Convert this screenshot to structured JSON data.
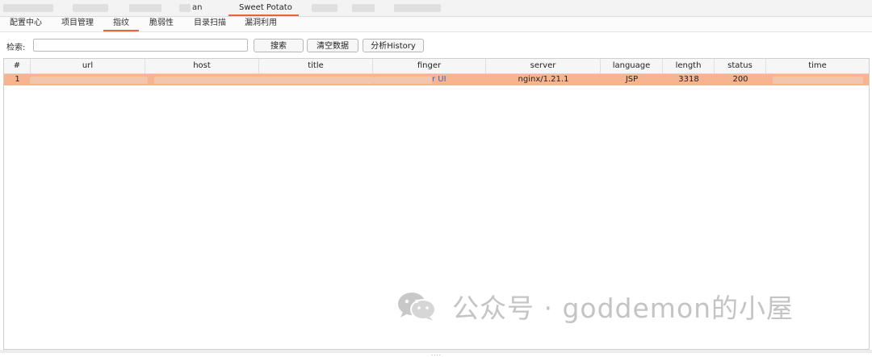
{
  "top_tabs": [
    {
      "label": "",
      "blurred": true
    },
    {
      "label": "",
      "blurred": true
    },
    {
      "label": "",
      "blurred": true
    },
    {
      "label": "an",
      "blurred": false
    },
    {
      "label": "Sweet Potato",
      "blurred": false,
      "active": true
    },
    {
      "label": "",
      "blurred": true
    },
    {
      "label": "",
      "blurred": true
    },
    {
      "label": "",
      "blurred": true
    }
  ],
  "sub_tabs": [
    "配置中心",
    "项目管理",
    "指纹",
    "脆弱性",
    "目录扫描",
    "漏洞利用"
  ],
  "active_sub_tab": "指纹",
  "search": {
    "label": "检索:",
    "value": "",
    "placeholder": ""
  },
  "buttons": {
    "search": "搜索",
    "clear": "清空数据",
    "history": "分析History"
  },
  "table": {
    "columns": [
      "#",
      "url",
      "host",
      "title",
      "finger",
      "server",
      "language",
      "length",
      "status",
      "time"
    ],
    "rows": [
      {
        "index": "1",
        "url": "",
        "host": "",
        "title": "",
        "finger": "r UI",
        "server": "nginx/1.21.1",
        "language": "JSP",
        "length": "3318",
        "status": "200",
        "time": ""
      }
    ]
  },
  "watermark": "公众号 · goddemon的小屋",
  "grip": "....",
  "colors": {
    "accent": "#e8623a",
    "selected_row": "#f7b48e",
    "link": "#3a64c8"
  }
}
